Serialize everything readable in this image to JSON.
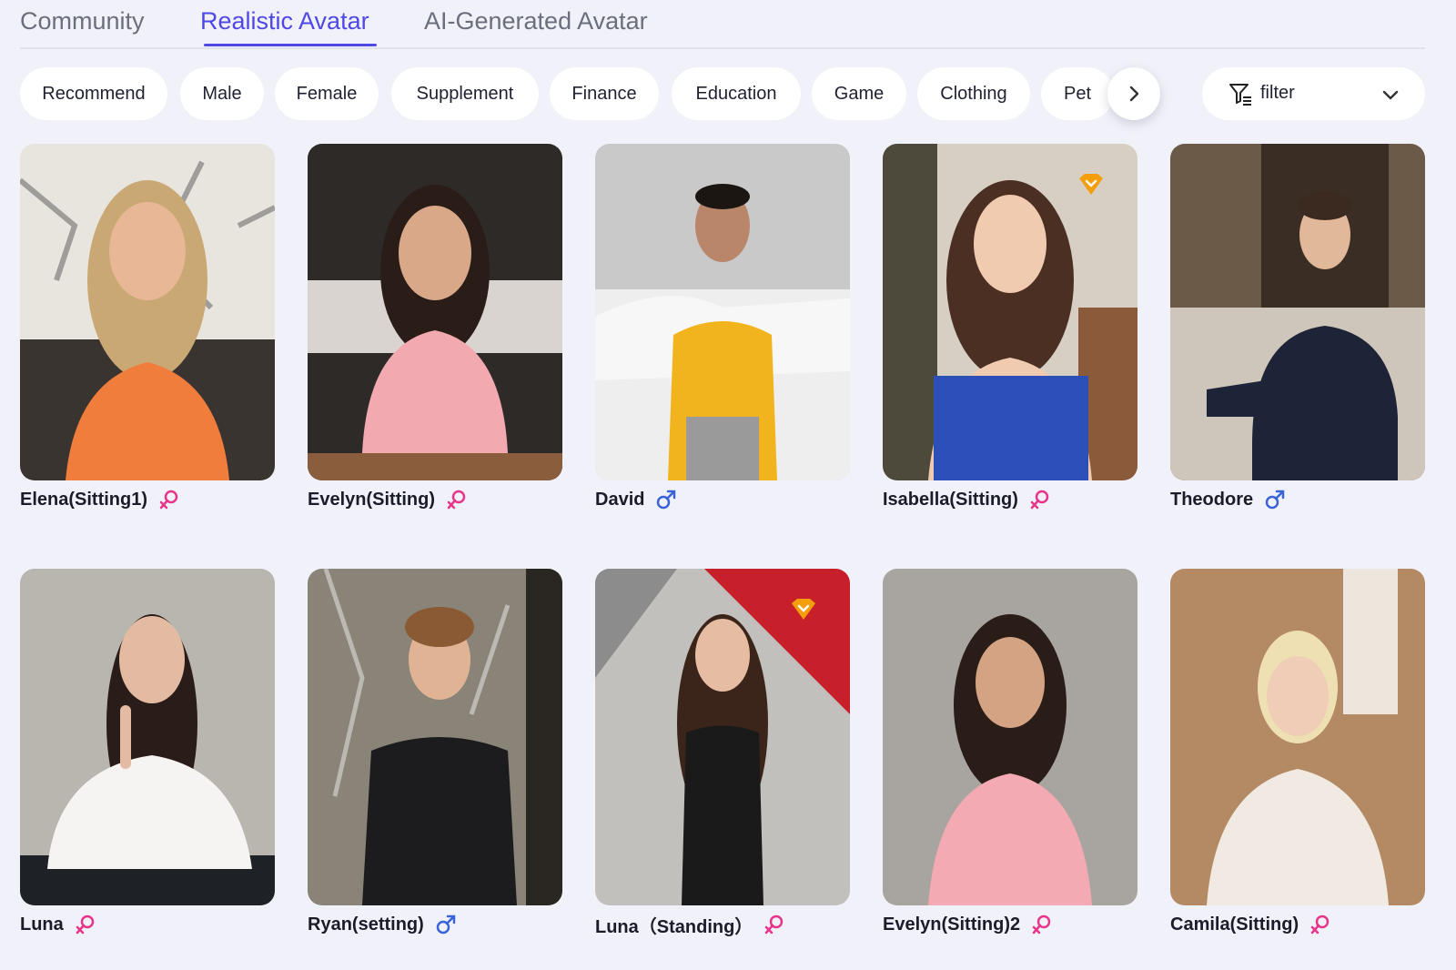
{
  "tabs": [
    {
      "label": "Community"
    },
    {
      "label": "Realistic Avatar",
      "active": true
    },
    {
      "label": "AI-Generated Avatar"
    }
  ],
  "categories": [
    "Recommend",
    "Male",
    "Female",
    "Supplement",
    "Finance",
    "Education",
    "Game",
    "Clothing",
    "Pet"
  ],
  "filter": {
    "label": "filter"
  },
  "colors": {
    "accent": "#5048e5",
    "female": "#e8348a",
    "male": "#3a63d8",
    "premium": "#f59e0b"
  },
  "avatars": [
    {
      "name": "Elena(Sitting1)",
      "gender": "female"
    },
    {
      "name": "Evelyn(Sitting)",
      "gender": "female"
    },
    {
      "name": "David",
      "gender": "male"
    },
    {
      "name": "Isabella(Sitting)",
      "gender": "female",
      "premium": true
    },
    {
      "name": "Theodore",
      "gender": "male"
    },
    {
      "name": "Luna",
      "gender": "female"
    },
    {
      "name": "Ryan(setting)",
      "gender": "male"
    },
    {
      "name": "Luna（Standing）",
      "gender": "female",
      "premium": true
    },
    {
      "name": "Evelyn(Sitting)2",
      "gender": "female"
    },
    {
      "name": "Camila(Sitting)",
      "gender": "female"
    }
  ]
}
